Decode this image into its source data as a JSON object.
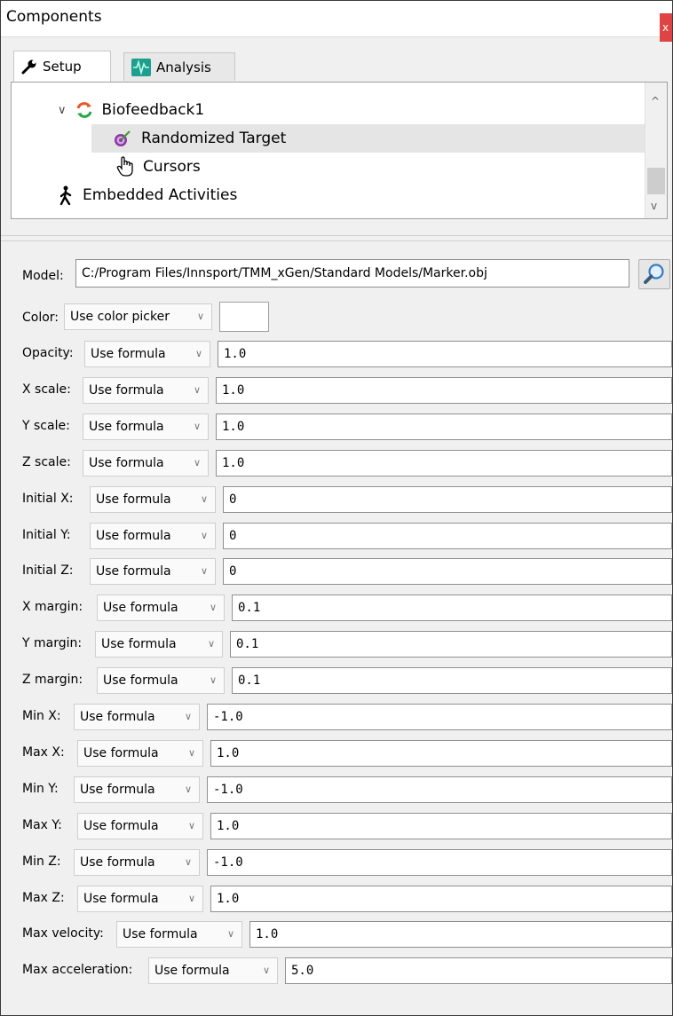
{
  "window": {
    "title": "Components",
    "close_glyph": "x"
  },
  "tabs": [
    {
      "label": "Setup",
      "icon": "wrench-icon",
      "active": true
    },
    {
      "label": "Analysis",
      "icon": "waveform-icon",
      "active": false
    }
  ],
  "tree": {
    "items": [
      {
        "label": "Biofeedback1",
        "icon": "biofeedback-icon",
        "expanded": true
      },
      {
        "label": "Randomized Target",
        "icon": "target-icon",
        "selected": true
      },
      {
        "label": "Cursors",
        "icon": "hand-cursor-icon"
      },
      {
        "label": "Embedded Activities",
        "icon": "walking-person-icon"
      }
    ],
    "scroll_up": "^",
    "scroll_down": "v"
  },
  "model": {
    "label": "Model:",
    "value": "C:/Program Files/Innsport/TMM_xGen/Standard Models/Marker.obj"
  },
  "color": {
    "label": "Color:",
    "mode": "Use color picker",
    "swatch": "#ffffff"
  },
  "properties": [
    {
      "label": "Opacity:",
      "mode": "Use formula",
      "value": "1.0"
    },
    {
      "label": "X scale:",
      "mode": "Use formula",
      "value": "1.0"
    },
    {
      "label": "Y scale:",
      "mode": "Use formula",
      "value": "1.0"
    },
    {
      "label": "Z scale:",
      "mode": "Use formula",
      "value": "1.0"
    },
    {
      "label": "Initial X:",
      "mode": "Use formula",
      "value": "0"
    },
    {
      "label": "Initial Y:",
      "mode": "Use formula",
      "value": "0"
    },
    {
      "label": "Initial Z:",
      "mode": "Use formula",
      "value": "0"
    },
    {
      "label": "X margin:",
      "mode": "Use formula",
      "value": "0.1"
    },
    {
      "label": "Y margin:",
      "mode": "Use formula",
      "value": "0.1"
    },
    {
      "label": "Z margin:",
      "mode": "Use formula",
      "value": "0.1"
    },
    {
      "label": "Min X:",
      "mode": "Use formula",
      "value": "-1.0"
    },
    {
      "label": "Max X:",
      "mode": "Use formula",
      "value": "1.0"
    },
    {
      "label": "Min Y:",
      "mode": "Use formula",
      "value": "-1.0"
    },
    {
      "label": "Max Y:",
      "mode": "Use formula",
      "value": "1.0"
    },
    {
      "label": "Min Z:",
      "mode": "Use formula",
      "value": "-1.0"
    },
    {
      "label": "Max Z:",
      "mode": "Use formula",
      "value": "1.0"
    },
    {
      "label": "Max velocity:",
      "mode": "Use formula",
      "value": "1.0"
    },
    {
      "label": "Max acceleration:",
      "mode": "Use formula",
      "value": "5.0"
    }
  ],
  "colors": {
    "accent_close": "#e04343",
    "selection": "#e5e5e5"
  }
}
